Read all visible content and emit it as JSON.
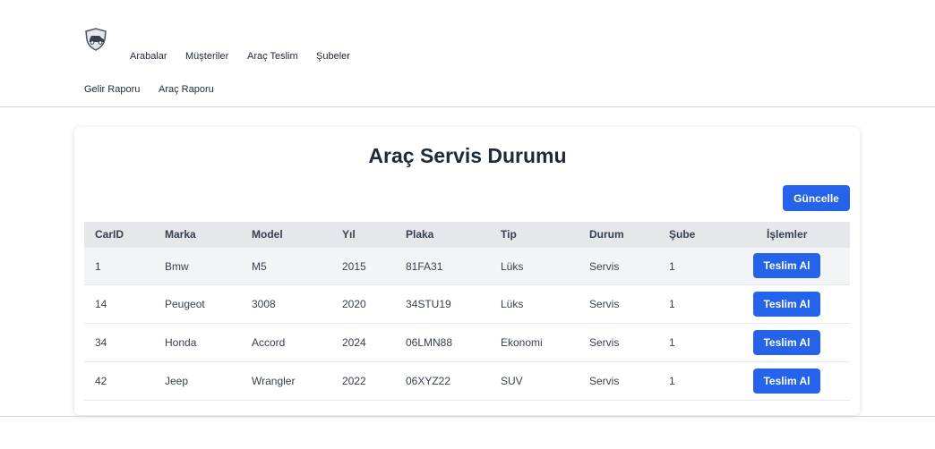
{
  "nav": {
    "logo": "car-logo-icon",
    "items": [
      {
        "label": "Arabalar"
      },
      {
        "label": "Müşteriler"
      },
      {
        "label": "Araç Teslim"
      },
      {
        "label": "Şubeler"
      },
      {
        "label": "Gelir Raporu"
      },
      {
        "label": "Araç Raporu"
      }
    ]
  },
  "main": {
    "title": "Araç Servis Durumu",
    "update_label": "Güncelle"
  },
  "table": {
    "headers": [
      "CarID",
      "Marka",
      "Model",
      "Yıl",
      "Plaka",
      "Tip",
      "Durum",
      "Şube",
      "İşlemler"
    ],
    "action_label": "Teslim Al",
    "rows": [
      [
        "1",
        "Bmw",
        "M5",
        "2015",
        "81FA31",
        "Lüks",
        "Servis",
        "1"
      ],
      [
        "14",
        "Peugeot",
        "3008",
        "2020",
        "34STU19",
        "Lüks",
        "Servis",
        "1"
      ],
      [
        "34",
        "Honda",
        "Accord",
        "2024",
        "06LMN88",
        "Ekonomi",
        "Servis",
        "1"
      ],
      [
        "42",
        "Jeep",
        "Wrangler",
        "2022",
        "06XYZ22",
        "SUV",
        "Servis",
        "1"
      ]
    ]
  },
  "colors": {
    "accent": "#2563eb",
    "header_bg": "#e5e7eb",
    "highlight_row": "#f3f4f6"
  }
}
